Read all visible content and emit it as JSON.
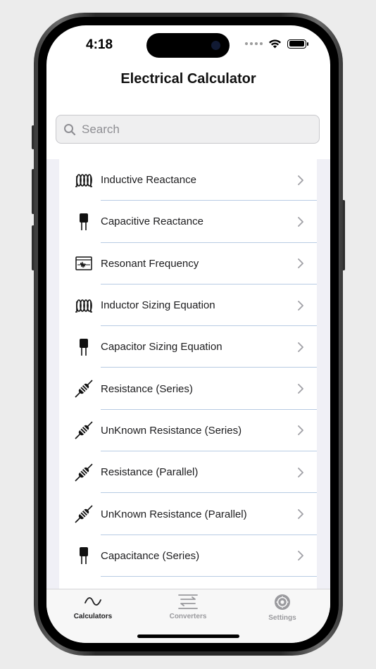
{
  "status": {
    "time": "4:18"
  },
  "nav": {
    "title": "Electrical Calculator"
  },
  "search": {
    "placeholder": "Search",
    "value": ""
  },
  "list": {
    "items": [
      {
        "label": "Inductive Reactance",
        "icon": "inductor-coil-icon"
      },
      {
        "label": "Capacitive Reactance",
        "icon": "capacitor-icon"
      },
      {
        "label": "Resonant Frequency",
        "icon": "oscilloscope-icon"
      },
      {
        "label": "Inductor Sizing Equation",
        "icon": "inductor-coil-icon"
      },
      {
        "label": "Capacitor Sizing Equation",
        "icon": "capacitor-icon"
      },
      {
        "label": "Resistance (Series)",
        "icon": "resistor-icon"
      },
      {
        "label": "UnKnown Resistance (Series)",
        "icon": "resistor-icon"
      },
      {
        "label": "Resistance (Parallel)",
        "icon": "resistor-icon"
      },
      {
        "label": "UnKnown Resistance (Parallel)",
        "icon": "resistor-icon"
      },
      {
        "label": "Capacitance (Series)",
        "icon": "capacitor-icon"
      }
    ]
  },
  "tabbar": {
    "tabs": [
      {
        "label": "Calculators",
        "icon": "sine-wave-icon",
        "active": true
      },
      {
        "label": "Converters",
        "icon": "swap-arrows-icon",
        "active": false
      },
      {
        "label": "Settings",
        "icon": "gear-icon",
        "active": false
      }
    ]
  },
  "colors": {
    "active_tab": "#1c1c1e",
    "inactive_tab": "#9a9a9e",
    "separator": "#b7cbe3"
  }
}
